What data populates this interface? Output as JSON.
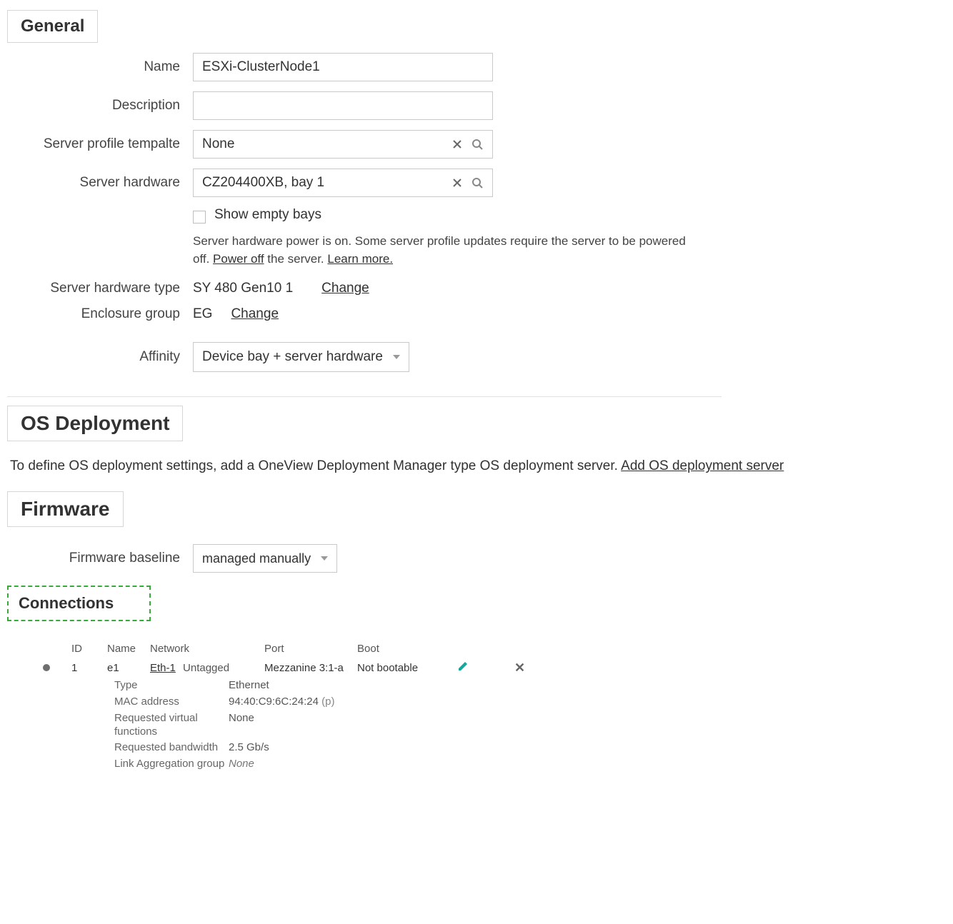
{
  "general": {
    "heading": "General",
    "name_label": "Name",
    "name_value": "ESXi-ClusterNode1",
    "description_label": "Description",
    "description_value": "",
    "spt_label": "Server profile tempalte",
    "spt_value": "None",
    "hw_label": "Server hardware",
    "hw_value": "CZ204400XB, bay 1",
    "show_empty_label": "Show empty bays",
    "power_hint_prefix": "Server hardware power is on. Some server profile updates require the server to be powered off. ",
    "power_off_link": "Power off",
    "power_hint_mid": " the server. ",
    "learn_more_link": "Learn more.",
    "hw_type_label": "Server hardware type",
    "hw_type_value": "SY 480 Gen10 1",
    "change_label": "Change",
    "enc_group_label": "Enclosure group",
    "enc_group_value": "EG",
    "affinity_label": "Affinity",
    "affinity_value": "Device bay + server hardware"
  },
  "os": {
    "heading": "OS Deployment",
    "text_prefix": "To define OS deployment settings, add a OneView Deployment Manager type OS deployment server. ",
    "add_link": "Add OS deployment server"
  },
  "fw": {
    "heading": "Firmware",
    "baseline_label": "Firmware baseline",
    "baseline_value": "managed manually"
  },
  "conn": {
    "heading": "Connections",
    "cols": {
      "id": "ID",
      "name": "Name",
      "network": "Network",
      "port": "Port",
      "boot": "Boot"
    },
    "row": {
      "id": "1",
      "name": "e1",
      "network": "Eth-1",
      "tag": "Untagged",
      "port": "Mezzanine 3:1-a",
      "boot": "Not bootable"
    },
    "details": {
      "type_label": "Type",
      "type_value": "Ethernet",
      "mac_label": "MAC address",
      "mac_value": "94:40:C9:6C:24:24",
      "mac_suffix": " (p)",
      "rvf_label": "Requested virtual functions",
      "rvf_value": "None",
      "rbw_label": "Requested bandwidth",
      "rbw_value": "2.5 Gb/s",
      "lag_label": "Link Aggregation group",
      "lag_value": "None"
    }
  }
}
